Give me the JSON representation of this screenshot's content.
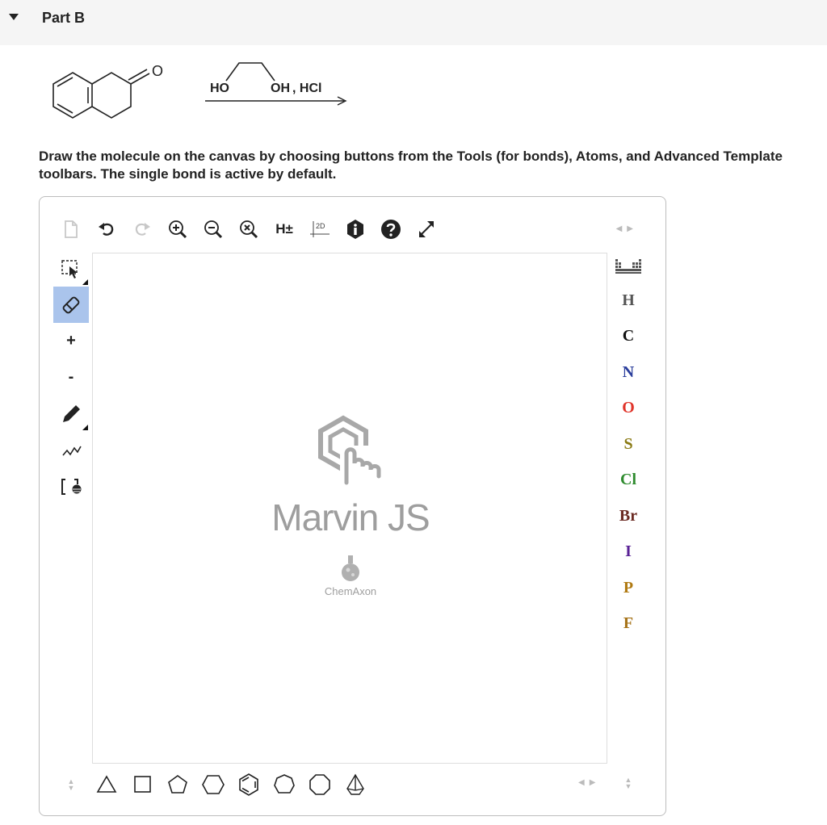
{
  "part": {
    "title": "Part B"
  },
  "reaction": {
    "reactant_label": "O",
    "reagent_left": "HO",
    "reagent_right": "OH",
    "reagent_acid": ", HCl"
  },
  "instructions": "Draw the molecule on the canvas by choosing buttons from the Tools (for bonds), Atoms, and Advanced Template toolbars. The single bond is active by default.",
  "editor": {
    "top_toolbar": [
      "new-document",
      "undo",
      "redo",
      "zoom-in",
      "zoom-out",
      "zoom-reset",
      "hydrogens",
      "2d-clean",
      "info",
      "help",
      "fullscreen"
    ],
    "hydrogens_label": "H±",
    "clean_label": "2D",
    "left_toolbar": [
      "select",
      "erase",
      "increase-charge",
      "decrease-charge",
      "single-bond",
      "chain",
      "bracket"
    ],
    "left_labels": {
      "plus": "+",
      "minus": "-"
    },
    "active_tool": "erase",
    "canvas": {
      "logo_title": "Marvin JS",
      "logo_sub": "ChemAxon"
    },
    "atoms": [
      {
        "symbol": "H",
        "color": "#555555"
      },
      {
        "symbol": "C",
        "color": "#111111"
      },
      {
        "symbol": "N",
        "color": "#2b3e9c"
      },
      {
        "symbol": "O",
        "color": "#e0342a"
      },
      {
        "symbol": "S",
        "color": "#8a7a14"
      },
      {
        "symbol": "Cl",
        "color": "#2e8b2e"
      },
      {
        "symbol": "Br",
        "color": "#6b2a22"
      },
      {
        "symbol": "I",
        "color": "#5a2296"
      },
      {
        "symbol": "P",
        "color": "#b07a12"
      },
      {
        "symbol": "F",
        "color": "#a67318"
      }
    ],
    "templates": [
      "cyclopropane",
      "cyclobutane",
      "cyclopentane",
      "cyclohexane",
      "benzene",
      "cycloheptane",
      "cyclooctane",
      "bicyclo"
    ]
  }
}
